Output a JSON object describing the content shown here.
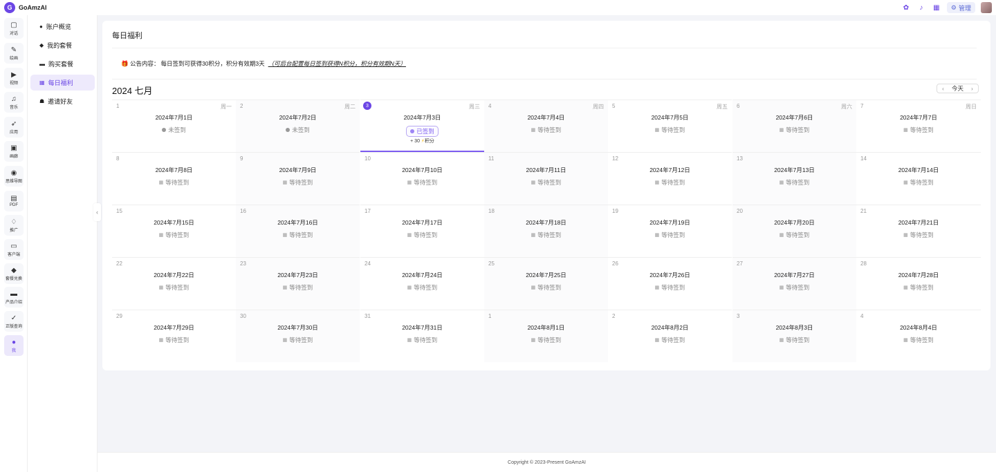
{
  "app": {
    "name": "GoAmzAI",
    "logo_text": "G",
    "admin_label": "管理"
  },
  "rail": [
    {
      "label": "对话",
      "icon": "chat-icon",
      "glyph": "▢",
      "active": false
    },
    {
      "label": "绘画",
      "icon": "brush-icon",
      "glyph": "✎",
      "active": false
    },
    {
      "label": "视频",
      "icon": "video-icon",
      "glyph": "▶",
      "active": false
    },
    {
      "label": "音乐",
      "icon": "music-icon",
      "glyph": "♫",
      "active": false
    },
    {
      "label": "应用",
      "icon": "rocket-icon",
      "glyph": "➶",
      "active": false
    },
    {
      "label": "画廊",
      "icon": "gallery-icon",
      "glyph": "▣",
      "active": false
    },
    {
      "label": "思维导图",
      "icon": "mindmap-icon",
      "glyph": "◉",
      "active": false
    },
    {
      "label": "PDF",
      "icon": "pdf-icon",
      "glyph": "▤",
      "active": false
    },
    {
      "label": "推广",
      "icon": "handshake-icon",
      "glyph": "♢",
      "active": false
    },
    {
      "label": "客户端",
      "icon": "monitor-icon",
      "glyph": "▭",
      "active": false
    },
    {
      "label": "套餐兑换",
      "icon": "diamond-icon",
      "glyph": "◆",
      "active": false
    },
    {
      "label": "产品介绍",
      "icon": "book-icon",
      "glyph": "▬",
      "active": false
    },
    {
      "label": "正版查询",
      "icon": "check-icon",
      "glyph": "✓",
      "active": false
    },
    {
      "label": "我",
      "icon": "user-icon",
      "glyph": "●",
      "active": true
    }
  ],
  "sidebar": [
    {
      "label": "账户概览",
      "icon": "user-icon",
      "glyph": "●",
      "active": false
    },
    {
      "label": "我的套餐",
      "icon": "diamond-icon",
      "glyph": "◆",
      "active": false
    },
    {
      "label": "购买套餐",
      "icon": "card-icon",
      "glyph": "▬",
      "active": false
    },
    {
      "label": "每日福利",
      "icon": "gift-icon",
      "glyph": "▦",
      "active": true
    },
    {
      "label": "邀请好友",
      "icon": "invite-icon",
      "glyph": "☗",
      "active": false
    }
  ],
  "page": {
    "title": "每日福利",
    "notice_prefix": "🎁 公告内容：",
    "notice_text": "每日签到可获得30积分，积分有效期3天",
    "notice_hint": "（可后台配置每日签到获得N积分，积分有效期N天）",
    "month_title": "2024 七月",
    "today_label": "今天",
    "prev_glyph": "‹",
    "next_glyph": "›"
  },
  "calendar": {
    "weekdays": [
      "周一",
      "周二",
      "周三",
      "周四",
      "周五",
      "周六",
      "周日"
    ],
    "status_pending": "等待签到",
    "status_missed": "未签到",
    "status_signed": "已签到",
    "points_prefix": "+ 30",
    "points_suffix": "积分",
    "days": [
      {
        "num": "1",
        "date": "2024年7月1日",
        "status": "missed"
      },
      {
        "num": "2",
        "date": "2024年7月2日",
        "status": "missed"
      },
      {
        "num": "3",
        "date": "2024年7月3日",
        "status": "signed",
        "today": true
      },
      {
        "num": "4",
        "date": "2024年7月4日",
        "status": "pending"
      },
      {
        "num": "5",
        "date": "2024年7月5日",
        "status": "pending"
      },
      {
        "num": "6",
        "date": "2024年7月6日",
        "status": "pending"
      },
      {
        "num": "7",
        "date": "2024年7月7日",
        "status": "pending"
      },
      {
        "num": "8",
        "date": "2024年7月8日",
        "status": "pending"
      },
      {
        "num": "9",
        "date": "2024年7月9日",
        "status": "pending"
      },
      {
        "num": "10",
        "date": "2024年7月10日",
        "status": "pending"
      },
      {
        "num": "11",
        "date": "2024年7月11日",
        "status": "pending"
      },
      {
        "num": "12",
        "date": "2024年7月12日",
        "status": "pending"
      },
      {
        "num": "13",
        "date": "2024年7月13日",
        "status": "pending"
      },
      {
        "num": "14",
        "date": "2024年7月14日",
        "status": "pending"
      },
      {
        "num": "15",
        "date": "2024年7月15日",
        "status": "pending"
      },
      {
        "num": "16",
        "date": "2024年7月16日",
        "status": "pending"
      },
      {
        "num": "17",
        "date": "2024年7月17日",
        "status": "pending"
      },
      {
        "num": "18",
        "date": "2024年7月18日",
        "status": "pending"
      },
      {
        "num": "19",
        "date": "2024年7月19日",
        "status": "pending"
      },
      {
        "num": "20",
        "date": "2024年7月20日",
        "status": "pending"
      },
      {
        "num": "21",
        "date": "2024年7月21日",
        "status": "pending"
      },
      {
        "num": "22",
        "date": "2024年7月22日",
        "status": "pending"
      },
      {
        "num": "23",
        "date": "2024年7月23日",
        "status": "pending"
      },
      {
        "num": "24",
        "date": "2024年7月24日",
        "status": "pending"
      },
      {
        "num": "25",
        "date": "2024年7月25日",
        "status": "pending"
      },
      {
        "num": "26",
        "date": "2024年7月26日",
        "status": "pending"
      },
      {
        "num": "27",
        "date": "2024年7月27日",
        "status": "pending"
      },
      {
        "num": "28",
        "date": "2024年7月28日",
        "status": "pending"
      },
      {
        "num": "29",
        "date": "2024年7月29日",
        "status": "pending"
      },
      {
        "num": "30",
        "date": "2024年7月30日",
        "status": "pending"
      },
      {
        "num": "31",
        "date": "2024年7月31日",
        "status": "pending"
      },
      {
        "num": "1",
        "date": "2024年8月1日",
        "status": "pending"
      },
      {
        "num": "2",
        "date": "2024年8月2日",
        "status": "pending"
      },
      {
        "num": "3",
        "date": "2024年8月3日",
        "status": "pending"
      },
      {
        "num": "4",
        "date": "2024年8月4日",
        "status": "pending"
      }
    ]
  },
  "footer": {
    "text": "Copyright © 2023-Present GoAmzAI"
  },
  "colors": {
    "accent": "#6b46e5",
    "background": "#f3f4f8"
  }
}
